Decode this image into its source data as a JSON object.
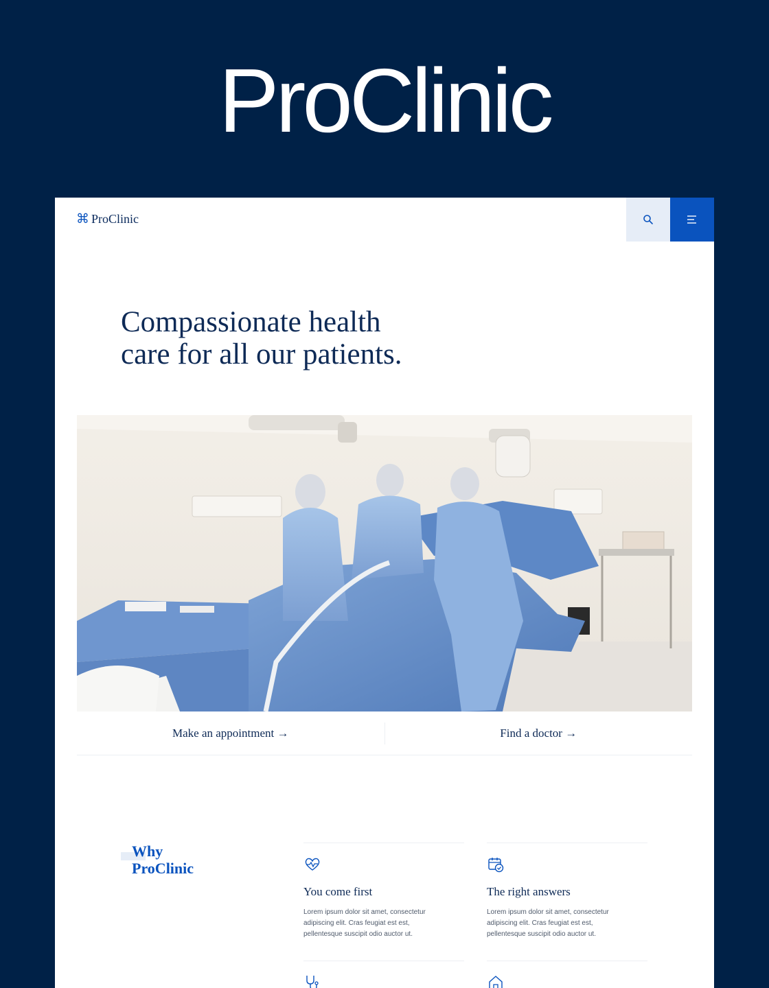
{
  "hero": {
    "brand": "ProClinic"
  },
  "header": {
    "logo_text": "ProClinic",
    "search_label": "Search",
    "menu_label": "Menu"
  },
  "headline": {
    "line1": "Compassionate health",
    "line2": "care for all our patients."
  },
  "photo": {
    "alt": "Surgeons performing an operation in a hospital operating room"
  },
  "cta": {
    "appointment": "Make an appointment →",
    "doctor": "Find a doctor →"
  },
  "why": {
    "line1": "Why",
    "line2": "ProClinic"
  },
  "features": [
    {
      "icon": "heart-pulse-icon",
      "title": "You come first",
      "body": "Lorem ipsum dolor sit amet, consectetur adipiscing elit. Cras feugiat est est, pellentesque suscipit odio auctor ut."
    },
    {
      "icon": "calendar-check-icon",
      "title": "The right answers",
      "body": "Lorem ipsum dolor sit amet, consectetur adipiscing elit. Cras feugiat est est, pellentesque suscipit odio auctor ut."
    },
    {
      "icon": "stethoscope-icon"
    },
    {
      "icon": "home-icon"
    }
  ],
  "colors": {
    "brand_navy": "#002147",
    "accent_blue": "#0a53be",
    "text_navy": "#0e2a56",
    "light_blue": "#e6edf7"
  }
}
